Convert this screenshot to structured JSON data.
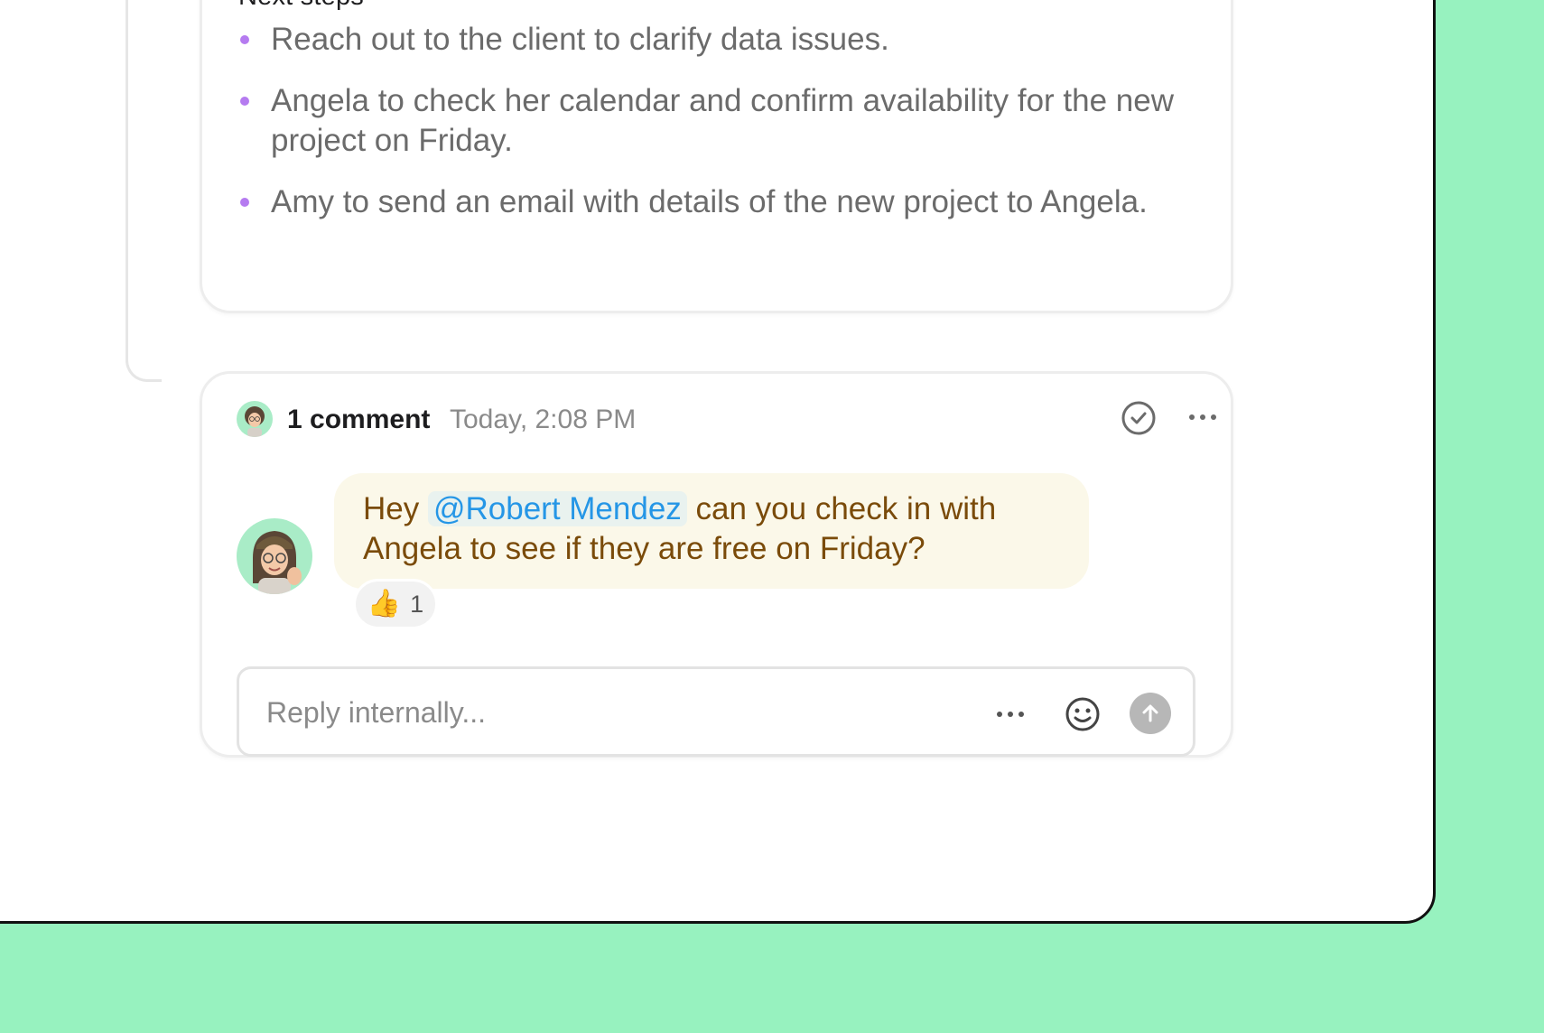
{
  "summary": {
    "section_title": "Next steps",
    "steps": [
      "Reach out to the client to clarify data issues.",
      "Angela to check her calendar and confirm availability for the new project on Friday.",
      "Amy to send an email with details of the new project to Angela."
    ]
  },
  "comment": {
    "count_label": "1 comment",
    "timestamp": "Today, 2:08 PM",
    "message": {
      "prefix": "Hey ",
      "mention": "@Robert Mendez",
      "suffix": " can you check in with Angela to see if they are free on Friday?"
    },
    "reaction": {
      "emoji": "👍",
      "count": "1"
    }
  },
  "reply": {
    "placeholder": "Reply internally..."
  },
  "colors": {
    "background": "#97f2bf",
    "bullet": "#b57bf0",
    "mention": "#2596e6",
    "bubble_text": "#7a4b0a",
    "bubble_bg": "#fbf8e9"
  },
  "icons": [
    "check-circle-icon",
    "more-horizontal-icon",
    "smiley-icon",
    "arrow-up-icon"
  ]
}
